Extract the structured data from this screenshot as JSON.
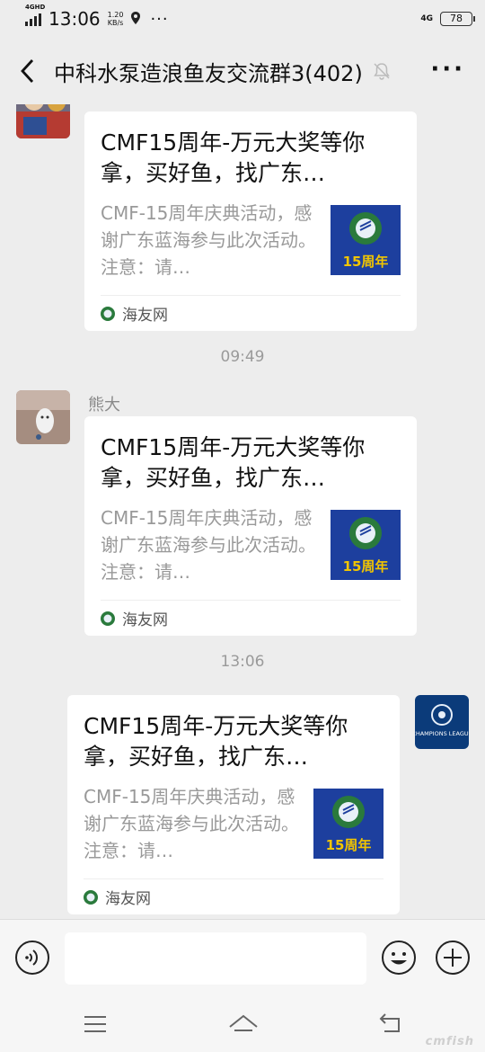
{
  "status_bar": {
    "network_tag": "4GHD",
    "time": "13:06",
    "speed_value": "1.20",
    "speed_unit": "KB/s",
    "dots": "···",
    "network_right": "4G",
    "battery": "78"
  },
  "header": {
    "title": "中科水泵造浪鱼友交流群3(402)",
    "more": "···"
  },
  "messages": [
    {
      "card": {
        "title": "CMF15周年-万元大奖等你拿，买好鱼，找广东…",
        "description": "CMF-15周年庆典活动，感谢广东蓝海参与此次活动。注意：请…",
        "source": "海友网"
      }
    },
    {
      "sender": "熊大",
      "card": {
        "title": "CMF15周年-万元大奖等你拿，买好鱼，找广东…",
        "description": "CMF-15周年庆典活动，感谢广东蓝海参与此次活动。注意：请…",
        "source": "海友网"
      }
    },
    {
      "card": {
        "title": "CMF15周年-万元大奖等你拿，买好鱼，找广东…",
        "description": "CMF-15周年庆典活动，感谢广东蓝海参与此次活动。注意：请…",
        "source": "海友网"
      }
    }
  ],
  "timestamps": [
    "09:49",
    "13:06"
  ],
  "thumbnail_text": "15周年",
  "self_avatar_text": "CHAMPIONS LEAGUE",
  "watermark": "cmfish",
  "colors": {
    "chat_bg": "#ededed",
    "card_bg": "#ffffff",
    "thumb_blue": "#1d3f9e",
    "thumb_yellow": "#f2c500",
    "icon_green": "#2a7a3c"
  }
}
